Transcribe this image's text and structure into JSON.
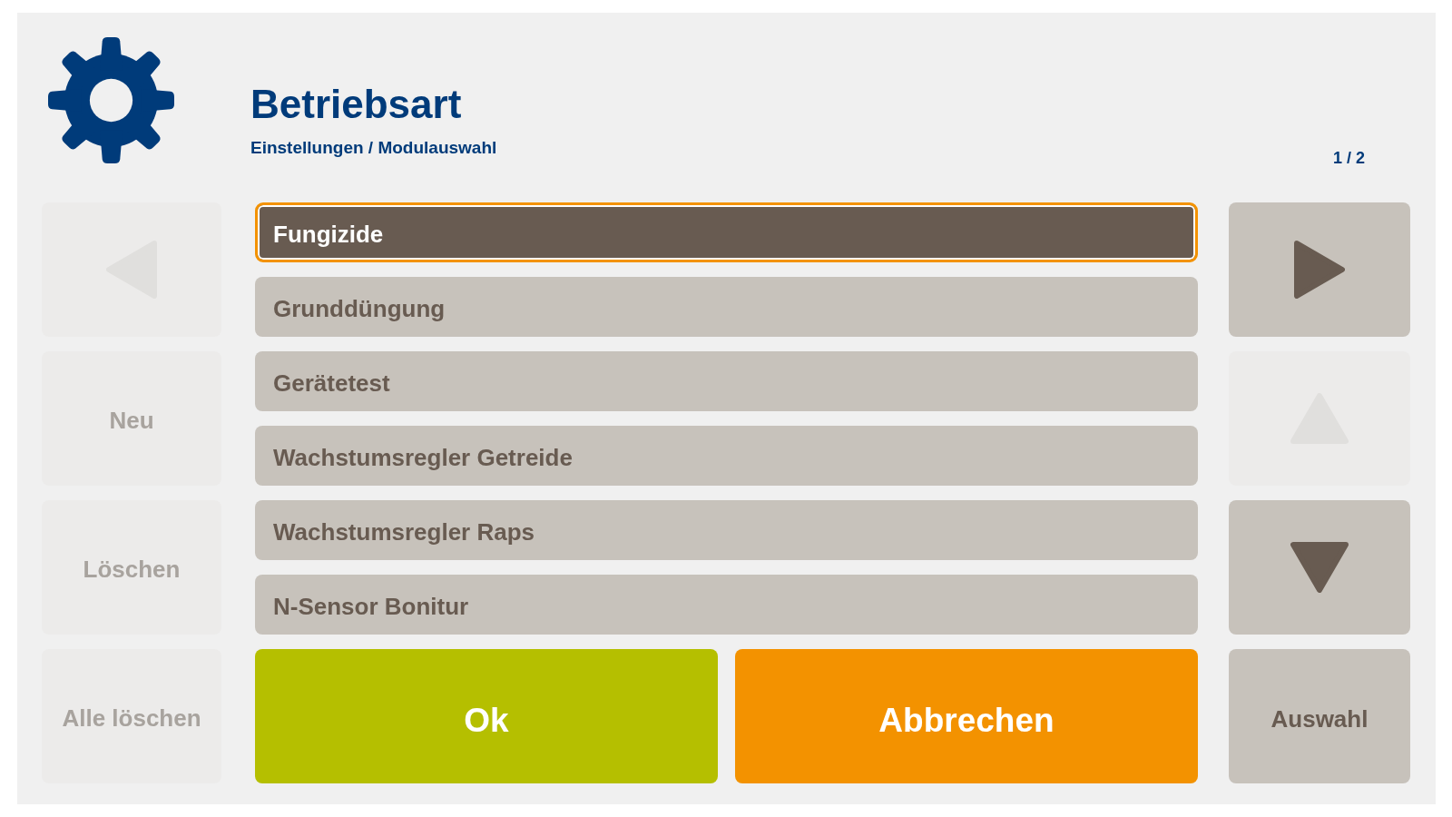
{
  "header": {
    "title": "Betriebsart",
    "breadcrumb": "Einstellungen / Modulauswahl",
    "page_indicator": "1 / 2"
  },
  "nav": {
    "previous": {
      "disabled": true
    },
    "next": {
      "disabled": false
    },
    "scroll_up": {
      "disabled": true
    },
    "scroll_down": {
      "disabled": false
    }
  },
  "left_buttons": [
    {
      "label": "Neu",
      "disabled": true
    },
    {
      "label": "Löschen",
      "disabled": true
    },
    {
      "label": "Alle löschen",
      "disabled": true
    }
  ],
  "list": [
    {
      "label": "Fungizide",
      "selected": true
    },
    {
      "label": "Grunddüngung",
      "selected": false
    },
    {
      "label": "Gerätetest",
      "selected": false
    },
    {
      "label": "Wachstumsregler Getreide",
      "selected": false
    },
    {
      "label": "Wachstumsregler Raps",
      "selected": false
    },
    {
      "label": "N-Sensor Bonitur",
      "selected": false
    }
  ],
  "actions": [
    {
      "kind": "confirm",
      "label": "Ok"
    },
    {
      "kind": "cancel",
      "label": "Abbrechen"
    }
  ],
  "select_button": {
    "label": "Auswahl",
    "disabled": false
  }
}
